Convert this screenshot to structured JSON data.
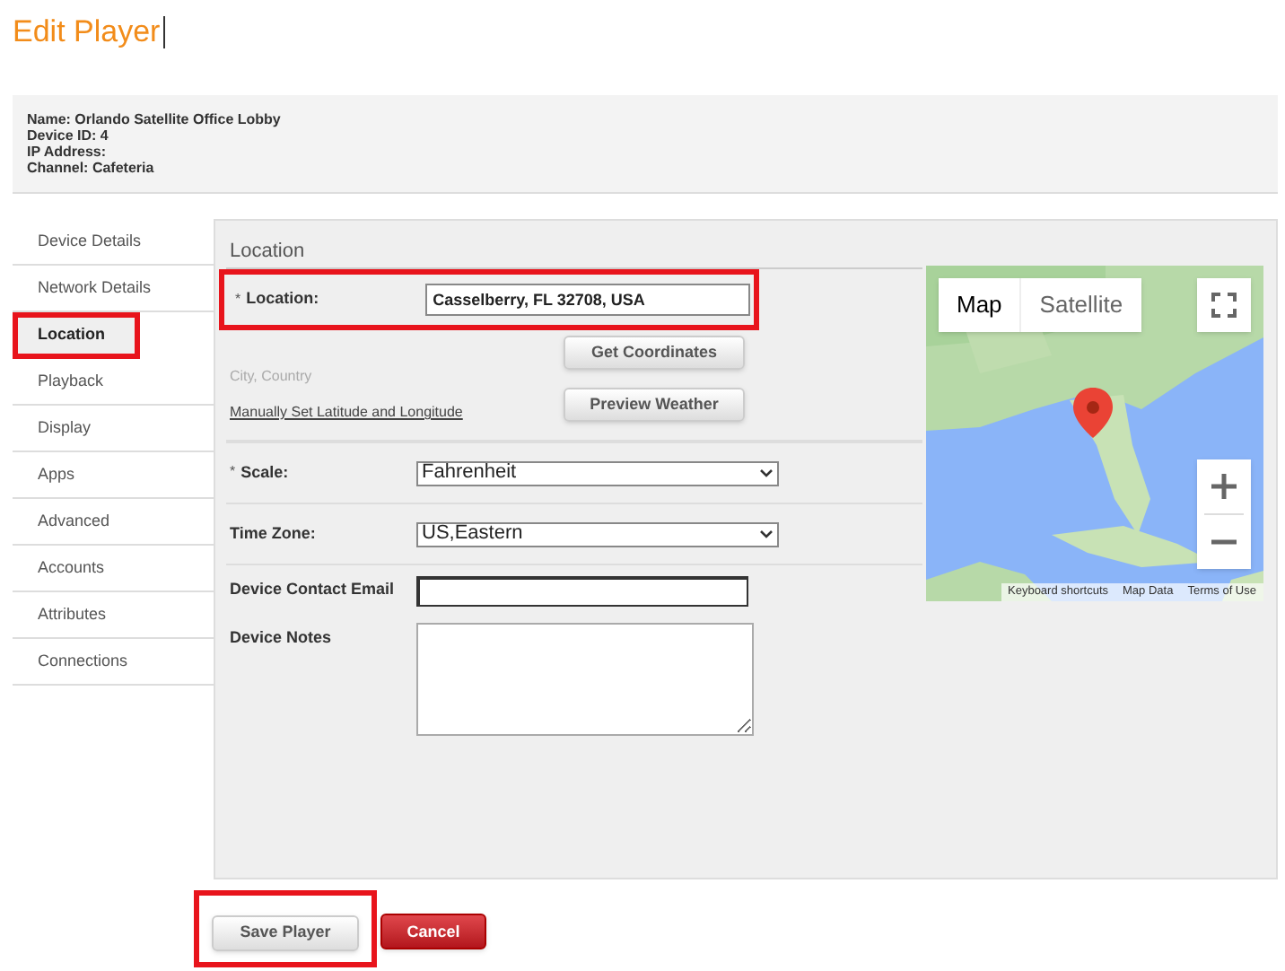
{
  "page_title": "Edit Player",
  "player_info": [
    "Name: Orlando Satellite Office Lobby",
    "Device ID: 4",
    "IP Address:",
    "Channel: Cafeteria"
  ],
  "sidebar": {
    "items": [
      {
        "label": "Device Details",
        "selected": false,
        "highlighted": false
      },
      {
        "label": "Network Details",
        "selected": false,
        "highlighted": false
      },
      {
        "label": "Location",
        "selected": true,
        "highlighted": true
      },
      {
        "label": "Playback",
        "selected": false,
        "highlighted": false
      },
      {
        "label": "Display",
        "selected": false,
        "highlighted": false
      },
      {
        "label": "Apps",
        "selected": false,
        "highlighted": false
      },
      {
        "label": "Advanced",
        "selected": false,
        "highlighted": false
      },
      {
        "label": "Accounts",
        "selected": false,
        "highlighted": false
      },
      {
        "label": "Attributes",
        "selected": false,
        "highlighted": false
      },
      {
        "label": "Connections",
        "selected": false,
        "highlighted": false
      }
    ]
  },
  "panel": {
    "title": "Location",
    "location": {
      "required_mark": "*",
      "label": "Location:",
      "value": "Casselberry, FL 32708, USA",
      "highlighted": true,
      "hint": "City, Country",
      "link": "Manually Set Latitude and Longitude",
      "buttons": [
        "Get Coordinates",
        "Preview Weather"
      ]
    },
    "fields": [
      {
        "kind": "select",
        "required_mark": "*",
        "label": "Scale:",
        "value": "Fahrenheit"
      },
      {
        "kind": "select",
        "label": "Time Zone:",
        "value": "US,Eastern"
      },
      {
        "kind": "text",
        "label": "Device Contact Email"
      },
      {
        "kind": "textarea",
        "label": "Device Notes"
      }
    ],
    "map": {
      "kind": "picture",
      "map_types": [
        {
          "label": "Map",
          "selected": true
        },
        {
          "label": "Satellite",
          "selected": false
        }
      ],
      "footer": [
        "Keyboard shortcuts",
        "Map Data",
        "Terms of Use"
      ]
    }
  },
  "actions": [
    {
      "label": "Save Player",
      "kind": "default",
      "highlighted": true
    },
    {
      "label": "Cancel",
      "kind": "danger",
      "highlighted": false
    }
  ]
}
